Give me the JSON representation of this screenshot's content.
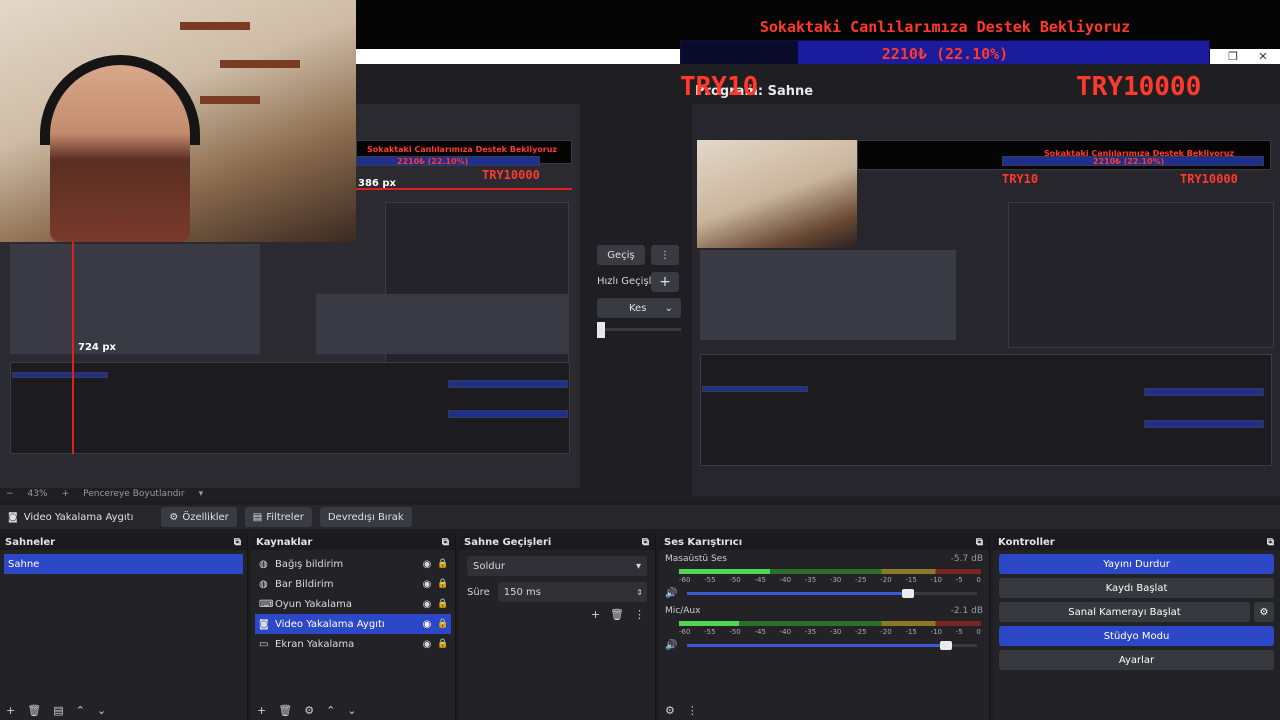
{
  "banner": {
    "title": "Sokaktaki Canlılarımıza Destek Bekliyoruz",
    "progress_text": "2210₺ (22.10%)",
    "progress_fraction": 0.221,
    "goal_small": "TRY10",
    "goal_big": "TRY10000",
    "win_restore": "❐",
    "win_close": "✕"
  },
  "preview": {
    "program_label": "Program: Sahne",
    "px_label_top": "386 px",
    "px_label_left": "724 px",
    "mini_title": "Sokaktaki Canlılarımıza Destek Bekliyoruz",
    "mini_progress": "2210₺ (22.10%)",
    "mini_goal": "TRY10000",
    "mini_goal_small": "TRY10"
  },
  "transition_panel": {
    "transition_button": "Geçiş",
    "quick_transitions_label": "Hızlı Geçişler",
    "cut_option": "Kes"
  },
  "zoom": {
    "percent": "43%",
    "fit_label": "Pencereye Boyutlandır"
  },
  "source_toolbar": {
    "source_name": "Video Yakalama Aygıtı",
    "properties": "Özellikler",
    "filters": "Filtreler",
    "deactivate": "Devredışı Bırak"
  },
  "scenes": {
    "title": "Sahneler",
    "items": [
      "Sahne"
    ]
  },
  "sources": {
    "title": "Kaynaklar",
    "items": [
      {
        "label": "Bağış bildirim",
        "icon": "globe-icon"
      },
      {
        "label": "Bar Bildirim",
        "icon": "globe-icon"
      },
      {
        "label": "Oyun Yakalama",
        "icon": "gamepad-icon"
      },
      {
        "label": "Video Yakalama Aygıtı",
        "icon": "camera-icon"
      },
      {
        "label": "Ekran Yakalama",
        "icon": "monitor-icon"
      }
    ]
  },
  "transitions": {
    "title": "Sahne Geçişleri",
    "selected": "Soldur",
    "duration_label": "Süre",
    "duration_value": "150 ms"
  },
  "mixer": {
    "title": "Ses Karıştırıcı",
    "channels": [
      {
        "name": "Masaüstü Ses",
        "db": "-5.7 dB",
        "level": 0.3,
        "volume": 0.76
      },
      {
        "name": "Mic/Aux",
        "db": "-2.1 dB",
        "level": 0.2,
        "volume": 0.89
      }
    ],
    "ticks": [
      "-60",
      "-55",
      "-50",
      "-45",
      "-40",
      "-35",
      "-30",
      "-25",
      "-20",
      "-15",
      "-10",
      "-5",
      "0"
    ]
  },
  "controls": {
    "title": "Kontroller",
    "stop_stream": "Yayını Durdur",
    "start_recording": "Kaydı Başlat",
    "start_virtual_camera": "Sanal Kamerayı Başlat",
    "studio_mode": "Stüdyo Modu",
    "settings": "Ayarlar"
  }
}
